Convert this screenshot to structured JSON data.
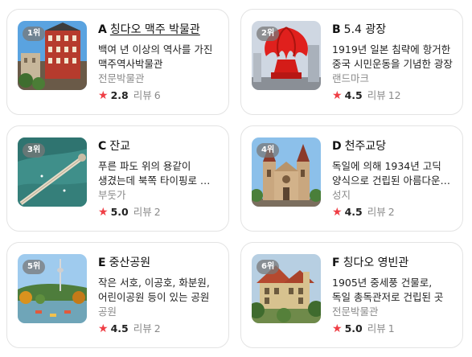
{
  "places": [
    {
      "rank": "1위",
      "letter": "A",
      "name": "칭다오 맥주 박물관",
      "description": "백여 년 이상의 역사를 가진 맥주역사박물관",
      "category": "전문박물관",
      "rating": "2.8",
      "review_label": "리뷰",
      "review_count": "6",
      "image": "beer-museum-photo"
    },
    {
      "rank": "2위",
      "letter": "B",
      "name": "5.4 광장",
      "description": "1919년 일본 침략에 항거한 중국 시민운동을 기념한 광장",
      "category": "랜드마크",
      "rating": "4.5",
      "review_label": "리뷰",
      "review_count": "12",
      "image": "may-fourth-square-photo"
    },
    {
      "rank": "3위",
      "letter": "C",
      "name": "잔교",
      "description": "푸른 파도 위의 용같이 생겼는데 북쪽 타이핑로 끝에 있다",
      "category": "부둣가",
      "rating": "5.0",
      "review_label": "리뷰",
      "review_count": "2",
      "image": "pier-photo"
    },
    {
      "rank": "4위",
      "letter": "D",
      "name": "천주교당",
      "description": "독일에 의해 1934년 고딕 양식으로 건립된 아름다운 성당",
      "category": "성지",
      "rating": "4.5",
      "review_label": "리뷰",
      "review_count": "2",
      "image": "cathedral-photo"
    },
    {
      "rank": "5위",
      "letter": "E",
      "name": "중산공원",
      "description": "작은 서호, 이공호, 화분원, 어린이공원 등이 있는 공원",
      "category": "공원",
      "rating": "4.5",
      "review_label": "리뷰",
      "review_count": "2",
      "image": "zhongshan-park-photo"
    },
    {
      "rank": "6위",
      "letter": "F",
      "name": "칭다오 영빈관",
      "description": "1905년 중세풍 건물로, 독일 총독관저로 건립된 곳",
      "category": "전문박물관",
      "rating": "5.0",
      "review_label": "리뷰",
      "review_count": "1",
      "image": "guest-house-photo"
    }
  ],
  "colors": {
    "star": "#ef3e45",
    "muted": "#8a8a8a",
    "border": "#e3e3e3"
  }
}
